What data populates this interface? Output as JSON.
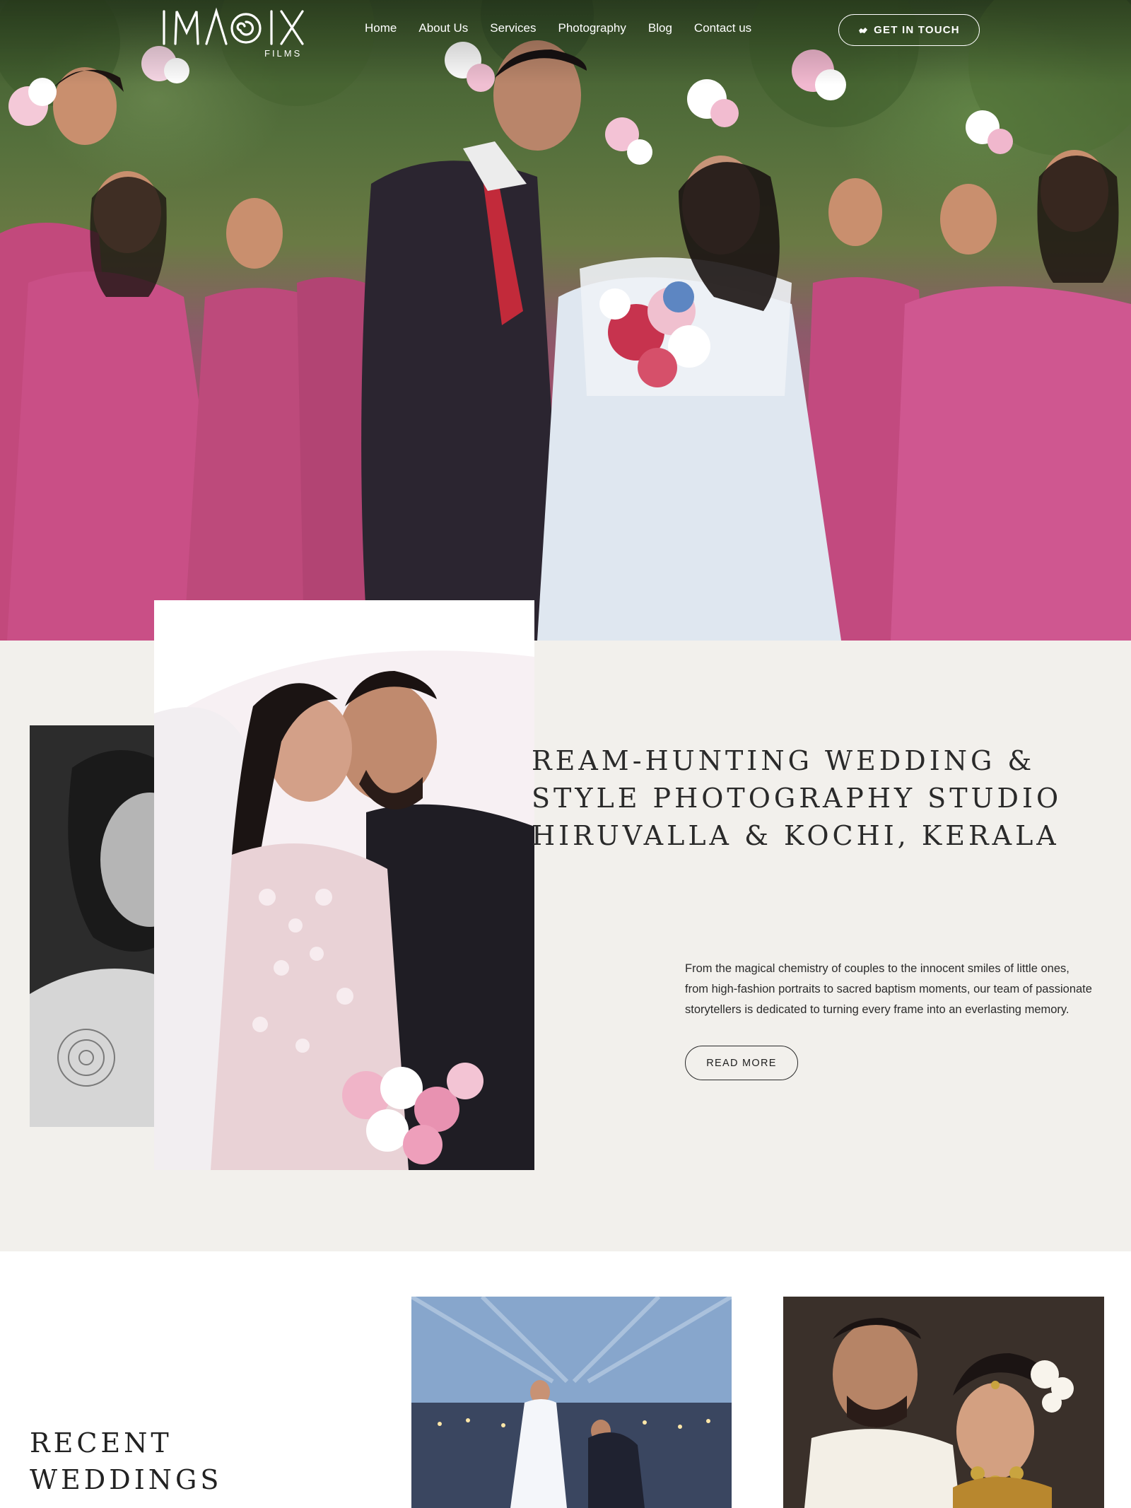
{
  "brand": {
    "logo_text": "IMAGIX",
    "logo_sub": "FILMS"
  },
  "nav": {
    "items": [
      "Home",
      "About Us",
      "Services",
      "Photography",
      "Blog",
      "Contact us"
    ],
    "cta_label": "GET IN TOUCH",
    "cta_icon": "handshake-icon"
  },
  "about": {
    "headline": [
      "REAM-HUNTING WEDDING &",
      "STYLE PHOTOGRAPHY STUDIO",
      "HIRUVALLA & KOCHI, KERALA"
    ],
    "blurb": "From the magical chemistry of couples to the innocent smiles of little ones, from high-fashion portraits to sacred baptism moments, our team of passionate storytellers is dedicated to turning every frame into an everlasting memory.",
    "read_more_label": "READ MORE"
  },
  "recent": {
    "title_line1": "RECENT",
    "title_line2": "WEDDINGS"
  },
  "colors": {
    "background_about": "#f2f0ec",
    "text_dark": "#2a2a2a",
    "dress_pink": "#c2497c",
    "white": "#ffffff"
  }
}
